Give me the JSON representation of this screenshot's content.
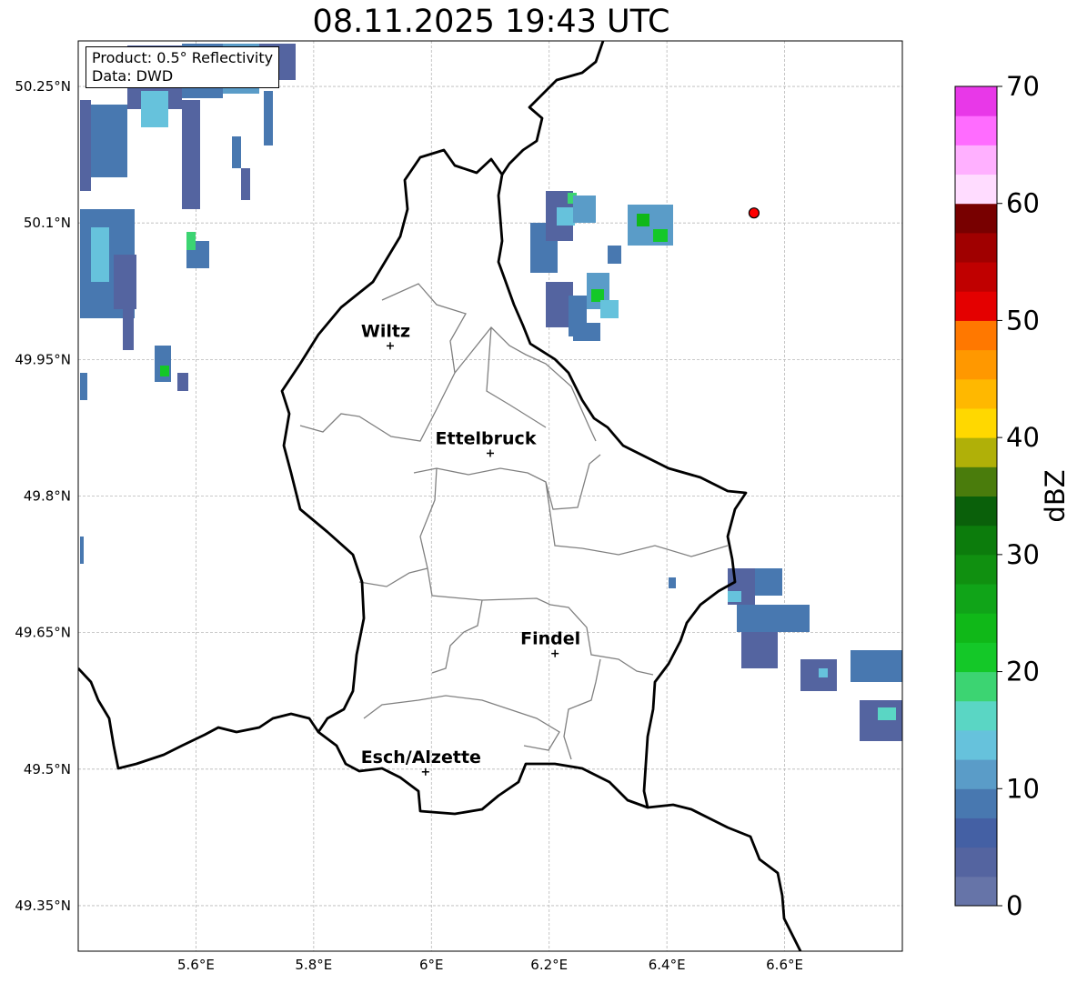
{
  "title": "08.11.2025 19:43 UTC",
  "info": {
    "product": "Product: 0.5° Reflectivity",
    "source": "Data: DWD"
  },
  "map": {
    "lon_range": [
      5.4,
      6.8
    ],
    "lat_range": [
      49.3,
      50.3
    ],
    "lon_ticks": [
      {
        "value": 5.6,
        "label": "5.6°E"
      },
      {
        "value": 5.8,
        "label": "5.8°E"
      },
      {
        "value": 6.0,
        "label": "6°E"
      },
      {
        "value": 6.2,
        "label": "6.2°E"
      },
      {
        "value": 6.4,
        "label": "6.4°E"
      },
      {
        "value": 6.6,
        "label": "6.6°E"
      }
    ],
    "lat_ticks": [
      {
        "value": 50.25,
        "label": "50.25°N"
      },
      {
        "value": 50.1,
        "label": "50.1°N"
      },
      {
        "value": 49.95,
        "label": "49.95°N"
      },
      {
        "value": 49.8,
        "label": "49.8°N"
      },
      {
        "value": 49.65,
        "label": "49.65°N"
      },
      {
        "value": 49.5,
        "label": "49.5°N"
      },
      {
        "value": 49.35,
        "label": "49.35°N"
      }
    ],
    "grid": true,
    "cities": [
      {
        "name": "Wiltz",
        "lon": 5.93,
        "lat": 49.965
      },
      {
        "name": "Ettelbruck",
        "lon": 6.1,
        "lat": 49.847
      },
      {
        "name": "Findel",
        "lon": 6.21,
        "lat": 49.627
      },
      {
        "name": "Esch/Alzette",
        "lon": 5.99,
        "lat": 49.497
      }
    ],
    "radar_site": {
      "lon": 6.548,
      "lat": 50.111,
      "color": "#ff0000"
    }
  },
  "colorbar": {
    "label": "dBZ",
    "min": 0,
    "max": 70,
    "ticks": [
      0,
      10,
      20,
      30,
      40,
      50,
      60,
      70
    ],
    "colors": [
      "#6674a8",
      "#5464a0",
      "#4460a4",
      "#4878b0",
      "#5a9cc8",
      "#66c2dc",
      "#5ad6c4",
      "#3cd472",
      "#14c828",
      "#10b818",
      "#10a418",
      "#109010",
      "#0c7c0c",
      "#0a600a",
      "#4a7c0c",
      "#b0b008",
      "#ffd800",
      "#ffb800",
      "#ff9800",
      "#ff7800",
      "#e40000",
      "#c00000",
      "#a00000",
      "#780000",
      "#ffdcff",
      "#ffb0ff",
      "#ff6cff",
      "#e838e8"
    ]
  }
}
